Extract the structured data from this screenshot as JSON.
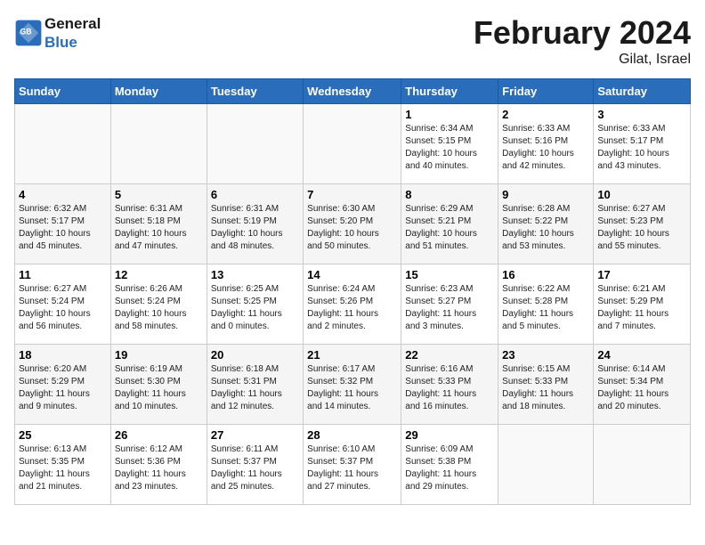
{
  "header": {
    "logo_general": "General",
    "logo_blue": "Blue",
    "month_title": "February 2024",
    "location": "Gilat, Israel"
  },
  "columns": [
    "Sunday",
    "Monday",
    "Tuesday",
    "Wednesday",
    "Thursday",
    "Friday",
    "Saturday"
  ],
  "weeks": [
    {
      "days": [
        {
          "num": "",
          "info": "",
          "empty": true
        },
        {
          "num": "",
          "info": "",
          "empty": true
        },
        {
          "num": "",
          "info": "",
          "empty": true
        },
        {
          "num": "",
          "info": "",
          "empty": true
        },
        {
          "num": "1",
          "info": "Sunrise: 6:34 AM\nSunset: 5:15 PM\nDaylight: 10 hours\nand 40 minutes.",
          "empty": false
        },
        {
          "num": "2",
          "info": "Sunrise: 6:33 AM\nSunset: 5:16 PM\nDaylight: 10 hours\nand 42 minutes.",
          "empty": false
        },
        {
          "num": "3",
          "info": "Sunrise: 6:33 AM\nSunset: 5:17 PM\nDaylight: 10 hours\nand 43 minutes.",
          "empty": false
        }
      ]
    },
    {
      "days": [
        {
          "num": "4",
          "info": "Sunrise: 6:32 AM\nSunset: 5:17 PM\nDaylight: 10 hours\nand 45 minutes.",
          "empty": false
        },
        {
          "num": "5",
          "info": "Sunrise: 6:31 AM\nSunset: 5:18 PM\nDaylight: 10 hours\nand 47 minutes.",
          "empty": false
        },
        {
          "num": "6",
          "info": "Sunrise: 6:31 AM\nSunset: 5:19 PM\nDaylight: 10 hours\nand 48 minutes.",
          "empty": false
        },
        {
          "num": "7",
          "info": "Sunrise: 6:30 AM\nSunset: 5:20 PM\nDaylight: 10 hours\nand 50 minutes.",
          "empty": false
        },
        {
          "num": "8",
          "info": "Sunrise: 6:29 AM\nSunset: 5:21 PM\nDaylight: 10 hours\nand 51 minutes.",
          "empty": false
        },
        {
          "num": "9",
          "info": "Sunrise: 6:28 AM\nSunset: 5:22 PM\nDaylight: 10 hours\nand 53 minutes.",
          "empty": false
        },
        {
          "num": "10",
          "info": "Sunrise: 6:27 AM\nSunset: 5:23 PM\nDaylight: 10 hours\nand 55 minutes.",
          "empty": false
        }
      ]
    },
    {
      "days": [
        {
          "num": "11",
          "info": "Sunrise: 6:27 AM\nSunset: 5:24 PM\nDaylight: 10 hours\nand 56 minutes.",
          "empty": false
        },
        {
          "num": "12",
          "info": "Sunrise: 6:26 AM\nSunset: 5:24 PM\nDaylight: 10 hours\nand 58 minutes.",
          "empty": false
        },
        {
          "num": "13",
          "info": "Sunrise: 6:25 AM\nSunset: 5:25 PM\nDaylight: 11 hours\nand 0 minutes.",
          "empty": false
        },
        {
          "num": "14",
          "info": "Sunrise: 6:24 AM\nSunset: 5:26 PM\nDaylight: 11 hours\nand 2 minutes.",
          "empty": false
        },
        {
          "num": "15",
          "info": "Sunrise: 6:23 AM\nSunset: 5:27 PM\nDaylight: 11 hours\nand 3 minutes.",
          "empty": false
        },
        {
          "num": "16",
          "info": "Sunrise: 6:22 AM\nSunset: 5:28 PM\nDaylight: 11 hours\nand 5 minutes.",
          "empty": false
        },
        {
          "num": "17",
          "info": "Sunrise: 6:21 AM\nSunset: 5:29 PM\nDaylight: 11 hours\nand 7 minutes.",
          "empty": false
        }
      ]
    },
    {
      "days": [
        {
          "num": "18",
          "info": "Sunrise: 6:20 AM\nSunset: 5:29 PM\nDaylight: 11 hours\nand 9 minutes.",
          "empty": false
        },
        {
          "num": "19",
          "info": "Sunrise: 6:19 AM\nSunset: 5:30 PM\nDaylight: 11 hours\nand 10 minutes.",
          "empty": false
        },
        {
          "num": "20",
          "info": "Sunrise: 6:18 AM\nSunset: 5:31 PM\nDaylight: 11 hours\nand 12 minutes.",
          "empty": false
        },
        {
          "num": "21",
          "info": "Sunrise: 6:17 AM\nSunset: 5:32 PM\nDaylight: 11 hours\nand 14 minutes.",
          "empty": false
        },
        {
          "num": "22",
          "info": "Sunrise: 6:16 AM\nSunset: 5:33 PM\nDaylight: 11 hours\nand 16 minutes.",
          "empty": false
        },
        {
          "num": "23",
          "info": "Sunrise: 6:15 AM\nSunset: 5:33 PM\nDaylight: 11 hours\nand 18 minutes.",
          "empty": false
        },
        {
          "num": "24",
          "info": "Sunrise: 6:14 AM\nSunset: 5:34 PM\nDaylight: 11 hours\nand 20 minutes.",
          "empty": false
        }
      ]
    },
    {
      "days": [
        {
          "num": "25",
          "info": "Sunrise: 6:13 AM\nSunset: 5:35 PM\nDaylight: 11 hours\nand 21 minutes.",
          "empty": false
        },
        {
          "num": "26",
          "info": "Sunrise: 6:12 AM\nSunset: 5:36 PM\nDaylight: 11 hours\nand 23 minutes.",
          "empty": false
        },
        {
          "num": "27",
          "info": "Sunrise: 6:11 AM\nSunset: 5:37 PM\nDaylight: 11 hours\nand 25 minutes.",
          "empty": false
        },
        {
          "num": "28",
          "info": "Sunrise: 6:10 AM\nSunset: 5:37 PM\nDaylight: 11 hours\nand 27 minutes.",
          "empty": false
        },
        {
          "num": "29",
          "info": "Sunrise: 6:09 AM\nSunset: 5:38 PM\nDaylight: 11 hours\nand 29 minutes.",
          "empty": false
        },
        {
          "num": "",
          "info": "",
          "empty": true
        },
        {
          "num": "",
          "info": "",
          "empty": true
        }
      ]
    }
  ]
}
